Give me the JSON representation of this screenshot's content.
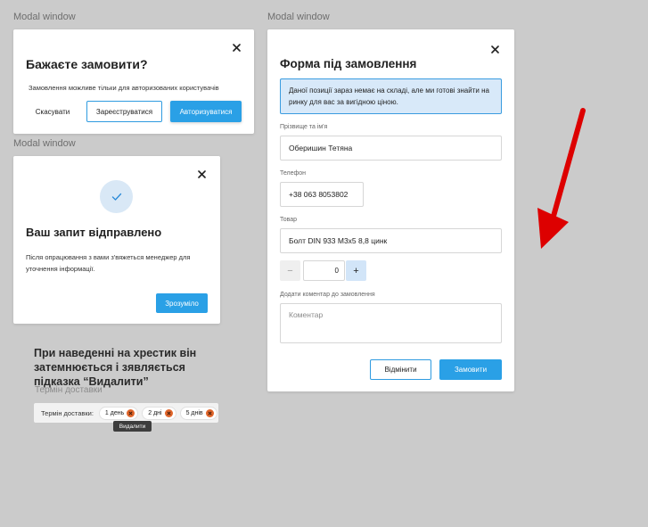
{
  "frames": {
    "label_1": "Modal window",
    "label_2": "Modal window",
    "label_3": "Modal window"
  },
  "confirm_modal": {
    "title": "Бажаєте замовити?",
    "description": "Замовлення можливе тільки для авторизованих користувачів",
    "cancel_label": "Скасувати",
    "register_label": "Зареєструватися",
    "login_label": "Авторизуватися"
  },
  "success_modal": {
    "title": "Ваш запит відправлено",
    "description": "Після опрацювання з вами з'вяжеться менеджер для уточнення інформації.",
    "ok_label": "Зрозуміло"
  },
  "hover_note": {
    "text": "При наведенні на хрестик він затемнюється і зявляється підказка “Видалити”",
    "ghost_text": "Термін доставки"
  },
  "delivery": {
    "label": "Термін доставки:",
    "chips": [
      "1 день",
      "2 дні",
      "5 днів"
    ],
    "tooltip": "Видалити"
  },
  "order_form": {
    "title": "Форма під замовлення",
    "info": "Даної позиції зараз немає на складі, але ми готові знайти на ринку для вас за вигідною ціною.",
    "name_label": "Прізвище та ім'я",
    "name_value": "Оберишин Тетяна",
    "phone_label": "Телефон",
    "phone_value": "+38 063 8053802",
    "product_label": "Товар",
    "product_value": "Болт DIN 933 М3х5 8,8 цинк",
    "quantity": "0",
    "minus_label": "−",
    "plus_label": "+",
    "comment_label": "Додати коментар до замовлення",
    "comment_placeholder": "Коментар",
    "cancel_label": "Відмінити",
    "submit_label": "Замовити"
  },
  "colors": {
    "background": "#cbcbcb",
    "accent": "#2aa0e6",
    "info_bg": "#d8e9f9",
    "chip_remove": "#e0652a",
    "arrow": "#dd0000"
  },
  "icons": {
    "close": "close-icon",
    "check": "check-icon",
    "remove": "remove-icon",
    "annotation_arrow": "arrow-icon"
  }
}
